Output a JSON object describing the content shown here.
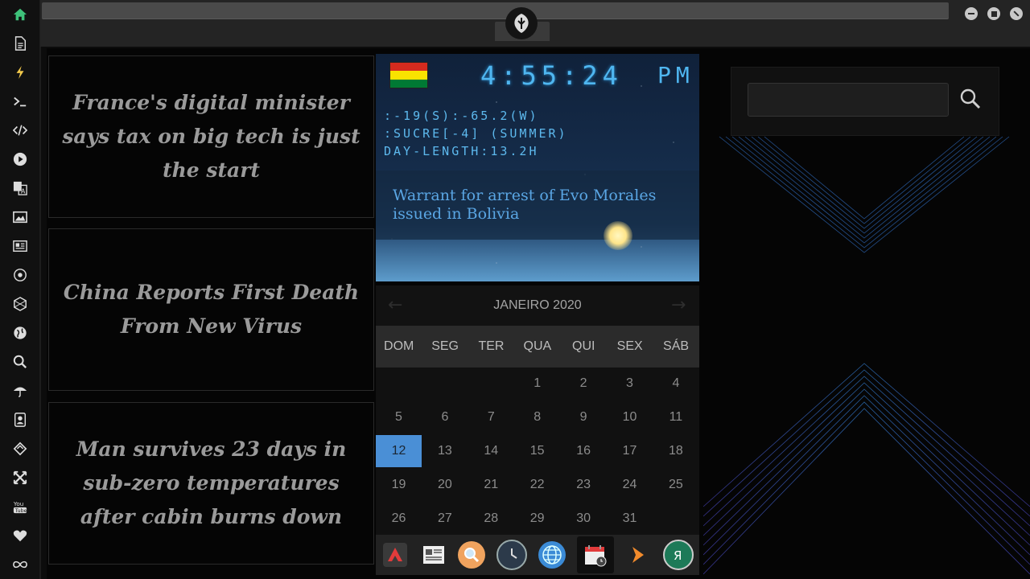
{
  "sidebar": {
    "items": [
      {
        "name": "home-icon",
        "glyph": "⌂"
      },
      {
        "name": "document-icon",
        "glyph": ""
      },
      {
        "name": "lightning-icon",
        "glyph": "⚡"
      },
      {
        "name": "terminal-icon",
        "glyph": ">_"
      },
      {
        "name": "code-icon",
        "glyph": "</>"
      },
      {
        "name": "play-icon",
        "glyph": "▶"
      },
      {
        "name": "translate-icon",
        "glyph": "A"
      },
      {
        "name": "image-icon",
        "glyph": ""
      },
      {
        "name": "newspaper-icon",
        "glyph": ""
      },
      {
        "name": "rebel-icon",
        "glyph": "✦"
      },
      {
        "name": "hexagon-icon",
        "glyph": "⬡"
      },
      {
        "name": "globe-icon",
        "glyph": "●"
      },
      {
        "name": "search-icon",
        "glyph": ""
      },
      {
        "name": "umbrella-icon",
        "glyph": "☂"
      },
      {
        "name": "contacts-icon",
        "glyph": ""
      },
      {
        "name": "tag-icon",
        "glyph": "◇"
      },
      {
        "name": "expand-icon",
        "glyph": "✣"
      },
      {
        "name": "youtube-icon",
        "glyph": "You"
      },
      {
        "name": "heart-icon",
        "glyph": "♥"
      },
      {
        "name": "infinity-icon",
        "glyph": "∞"
      }
    ]
  },
  "news": [
    "France's digital minister says tax on big tech is just the start",
    "China Reports First Death From New Virus",
    "Man survives 23 days in sub-zero temperatures after cabin burns down"
  ],
  "clock": {
    "time": "4:55:24",
    "ampm": "PM",
    "coords": ":-19(S):-65.2(W)",
    "timezone": ":SUCRE[-4] (SUMMER)",
    "day_length": "DAY-LENGTH:13.2H",
    "headline": "Warrant for arrest of Evo Morales issued in Bolivia",
    "flag_colors": [
      "#d52b1e",
      "#f9e300",
      "#007934"
    ]
  },
  "calendar": {
    "month": "JANEIRO 2020",
    "prev": "←",
    "next": "→",
    "weekdays": [
      "DOM",
      "SEG",
      "TER",
      "QUA",
      "QUI",
      "SEX",
      "SÁB"
    ],
    "first_weekday": 3,
    "days_in_month": 31,
    "today": 12,
    "today_color": "#4a8fd6"
  },
  "search": {
    "value": "",
    "placeholder": ""
  },
  "dock": [
    "app-launcher-icon",
    "news-app-icon",
    "search-app-icon",
    "clock-app-icon",
    "browser-globe-icon",
    "calendar-app-icon",
    "arrow-app-icon",
    "yandex-icon"
  ],
  "colors": {
    "accent": "#4fb6f0",
    "sidebar_home": "#3ec27a",
    "sidebar_bolt": "#f2c94c"
  }
}
